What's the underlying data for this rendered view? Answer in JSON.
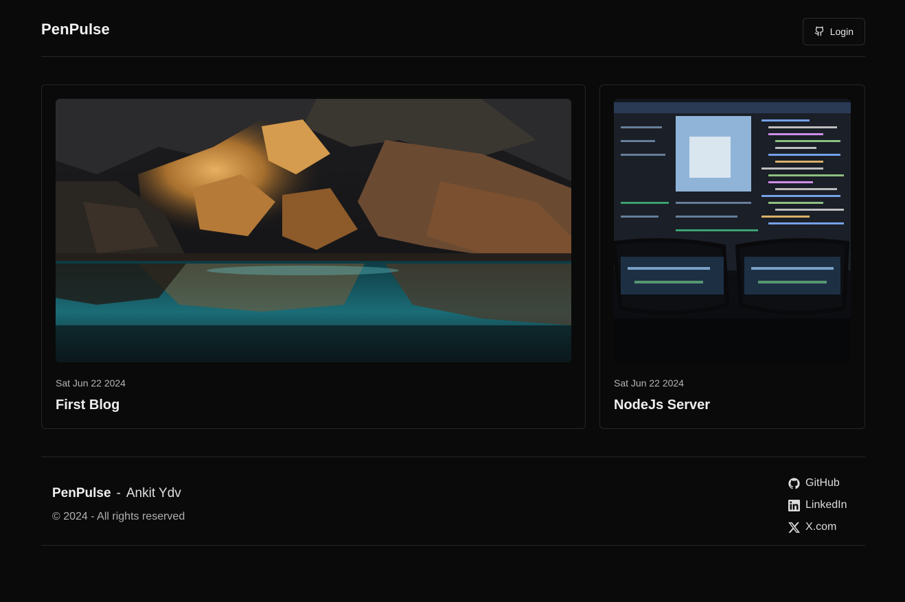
{
  "header": {
    "brand": "PenPulse",
    "login_label": "Login",
    "login_icon": "github-icon"
  },
  "posts": [
    {
      "date": "Sat Jun 22 2024",
      "title": "First Blog",
      "image": "cave-lake-photo"
    },
    {
      "date": "Sat Jun 22 2024",
      "title": "NodeJs Server",
      "image": "code-screen-glasses-photo"
    }
  ],
  "footer": {
    "brand": "PenPulse",
    "separator": "-",
    "author": "Ankit Ydv",
    "copyright": "© 2024 - All rights reserved",
    "links": [
      {
        "label": "GitHub",
        "icon": "github-icon"
      },
      {
        "label": "LinkedIn",
        "icon": "linkedin-icon"
      },
      {
        "label": "X.com",
        "icon": "x-icon"
      }
    ]
  },
  "colors": {
    "background": "#0a0a0a",
    "border": "#262626",
    "text": "#ededed",
    "muted": "#b5b5b5"
  }
}
